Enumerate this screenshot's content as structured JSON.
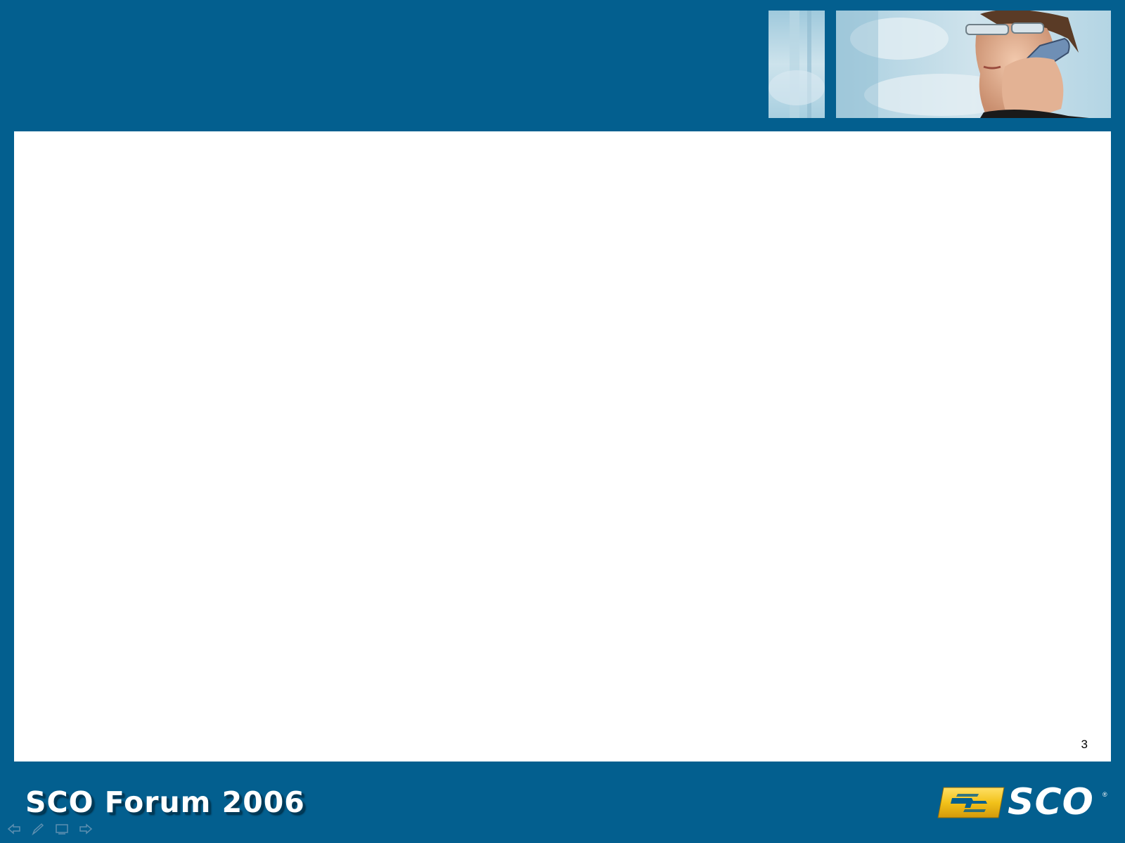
{
  "footer": {
    "title": "SCO Forum 2006"
  },
  "content": {
    "page_number": "3"
  },
  "logo": {
    "text": "SCO",
    "tm": "®"
  },
  "colors": {
    "background": "#035f8f",
    "content": "#ffffff",
    "logo_badge": "#f2c21a"
  },
  "nav": {
    "icons": [
      "back-arrow-icon",
      "pen-icon",
      "screen-icon",
      "forward-arrow-icon"
    ]
  }
}
